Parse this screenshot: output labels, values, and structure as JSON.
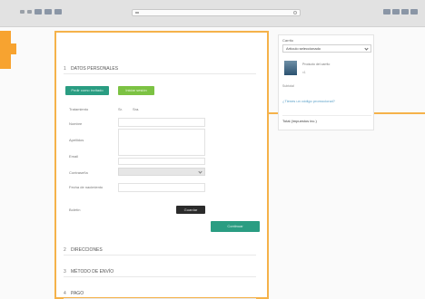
{
  "window": {
    "url": "",
    "tab_title": ""
  },
  "checkout": {
    "sections": [
      {
        "num": "1",
        "label": "DATOS PERSONALES"
      },
      {
        "num": "2",
        "label": "DIRECCIONES"
      },
      {
        "num": "3",
        "label": "MÉTODO DE ENVÍO"
      },
      {
        "num": "4",
        "label": "PAGO"
      }
    ],
    "buttons": {
      "guest": "Pedir como invitado",
      "login": "Iniciar sesión",
      "save": "Guardar",
      "continue": "Continuar"
    },
    "fields": {
      "title_label": "Tratamiento",
      "title_opt1": "Sr.",
      "title_opt2": "Sra.",
      "name_label": "Nombre",
      "surname_label": "Apellidos",
      "email_label": "Email",
      "password_label": "Contraseña",
      "birthdate_label": "Fecha de nacimiento",
      "newsletter_label": "Boletín"
    }
  },
  "summary": {
    "header": "Carrito",
    "selected": "Artículo seleccionado",
    "product_name": "Producto del carrito",
    "qty": "x1",
    "sub": "Subtotal",
    "promo": "¿Tienes un código promocional?",
    "total": "Total (impuestos inc.)"
  }
}
